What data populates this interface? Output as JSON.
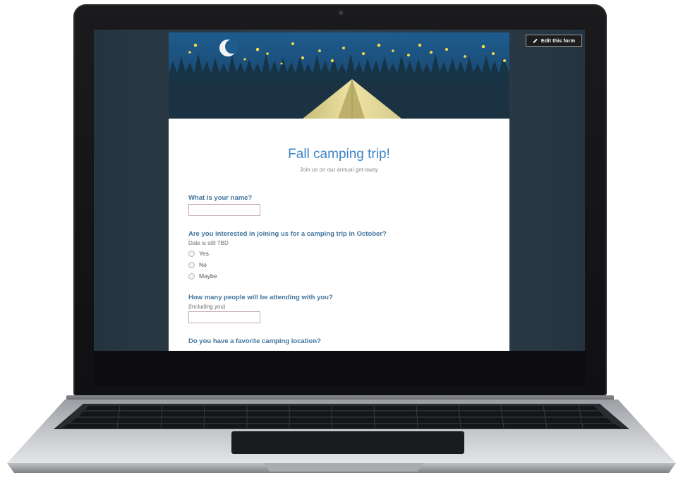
{
  "form": {
    "title": "Fall camping trip!",
    "description": "Join us on our annual get-away",
    "questions": [
      {
        "title": "What is your name?",
        "help": "",
        "type": "text"
      },
      {
        "title": "Are you interested in joining us for a camping trip in October?",
        "help": "Date is still TBD",
        "type": "radio",
        "options": [
          "Yes",
          "No",
          "Maybe"
        ]
      },
      {
        "title": "How many people will be attending with you?",
        "help": "(Including you)",
        "type": "text"
      },
      {
        "title": "Do you have a favorite camping location?",
        "help": "",
        "type": "text"
      }
    ]
  },
  "toolbar": {
    "edit_label": "Edit this form"
  },
  "icons": {
    "edit": "pencil-icon",
    "moon": "moon-icon",
    "tent": "tent-icon",
    "star": "star-icon"
  },
  "colors": {
    "title": "#3d84c6",
    "question": "#40749e",
    "banner_sky": "#1d4c76",
    "tent": "#e9dd9d",
    "screen_bg": "#2b3a45"
  }
}
